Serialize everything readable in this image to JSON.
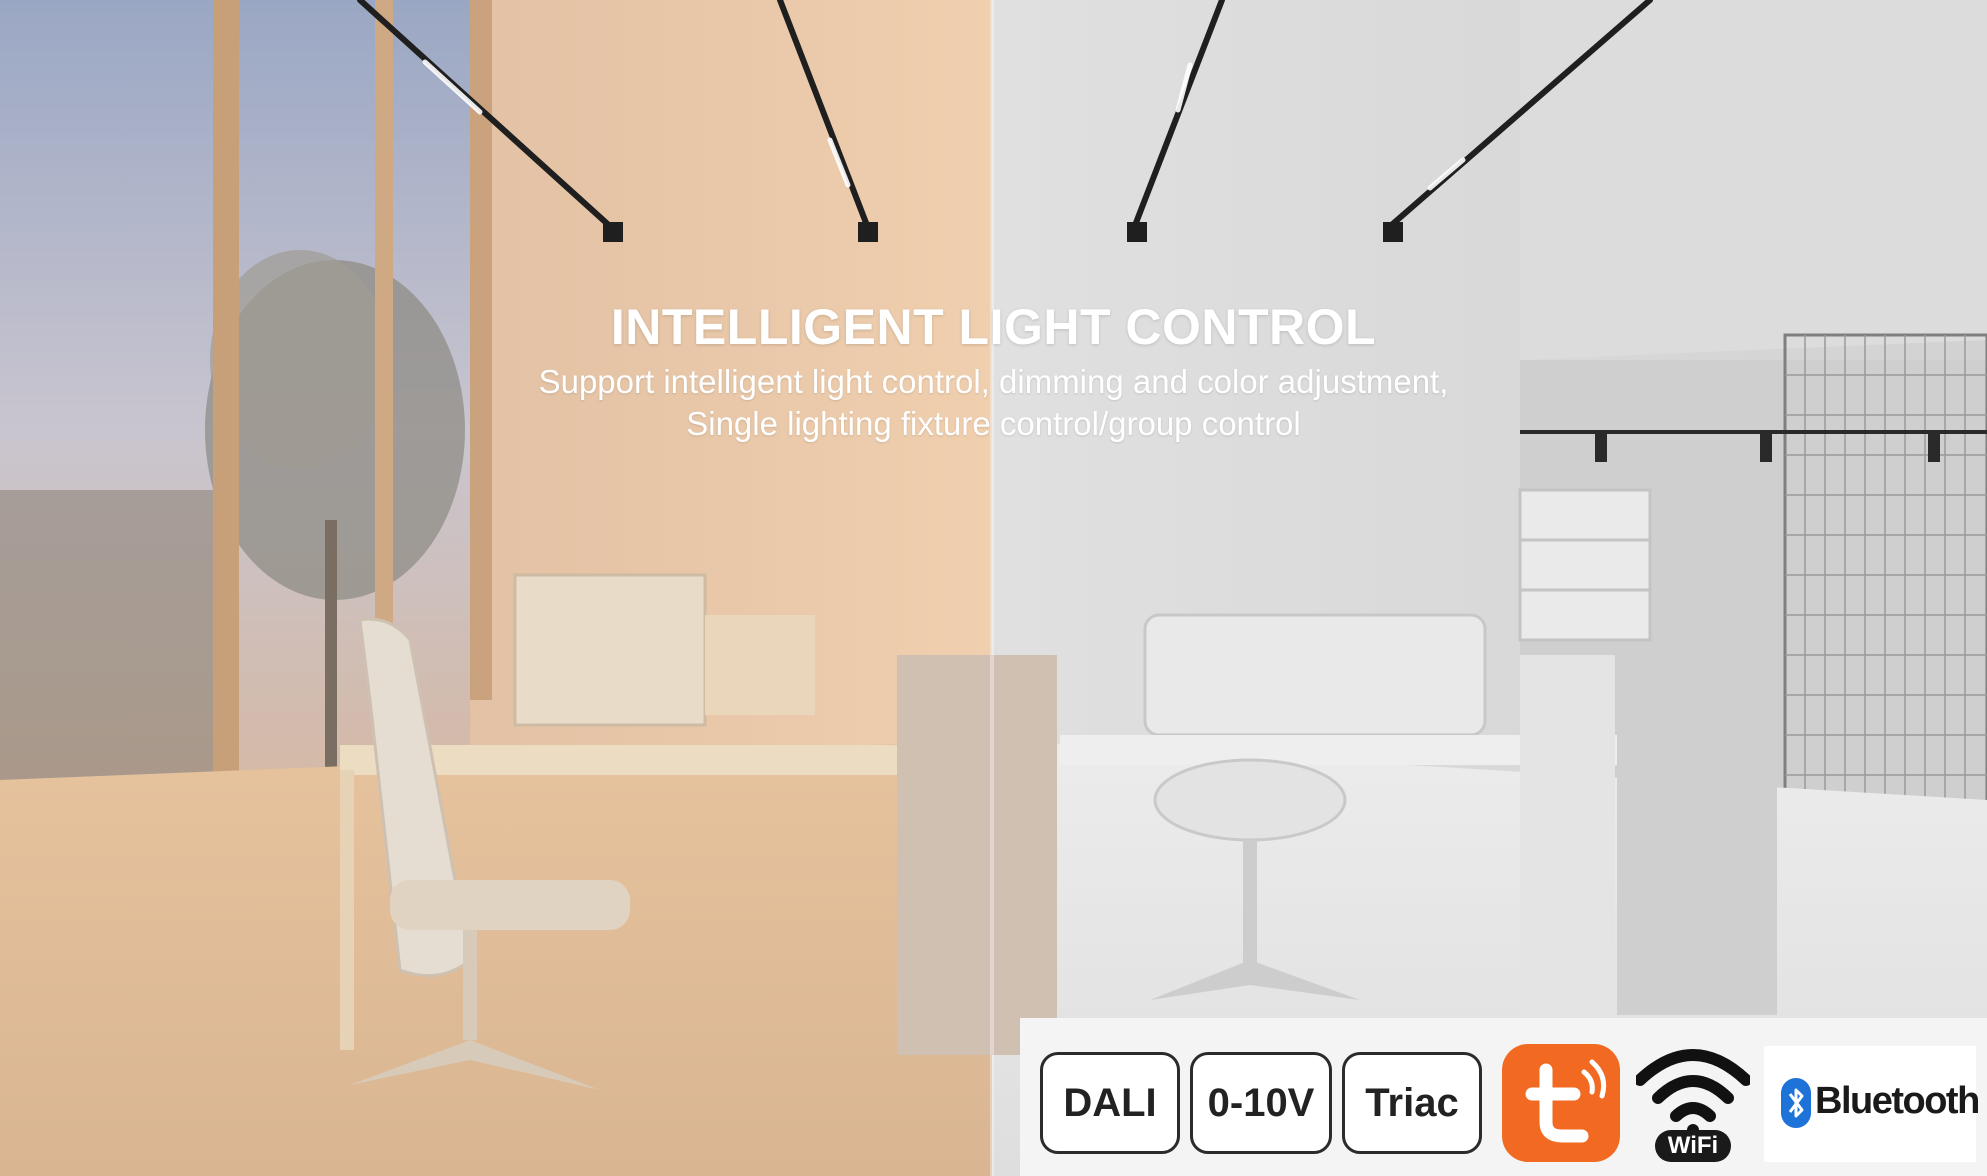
{
  "banner": {
    "title": "INTELLIGENT LIGHT CONTROL",
    "subtitle_line1": "Support intelligent light control, dimming and color adjustment,",
    "subtitle_line2": "Single lighting fixture control/group control"
  },
  "protocols": {
    "dali": "DALI",
    "zero_ten_v": "0-10V",
    "triac": "Triac",
    "wifi_label": "WiFi",
    "bluetooth_label": "Bluetooth"
  },
  "icons": {
    "tuya": "tuya-smart-icon",
    "wifi": "wifi-icon",
    "bluetooth": "bluetooth-icon"
  },
  "colors": {
    "tuya_orange": "#f26a22",
    "warm_tone": "#e8c9a2",
    "cool_tone": "#d9d9d9",
    "bluetooth_blue": "#1e73d8"
  }
}
